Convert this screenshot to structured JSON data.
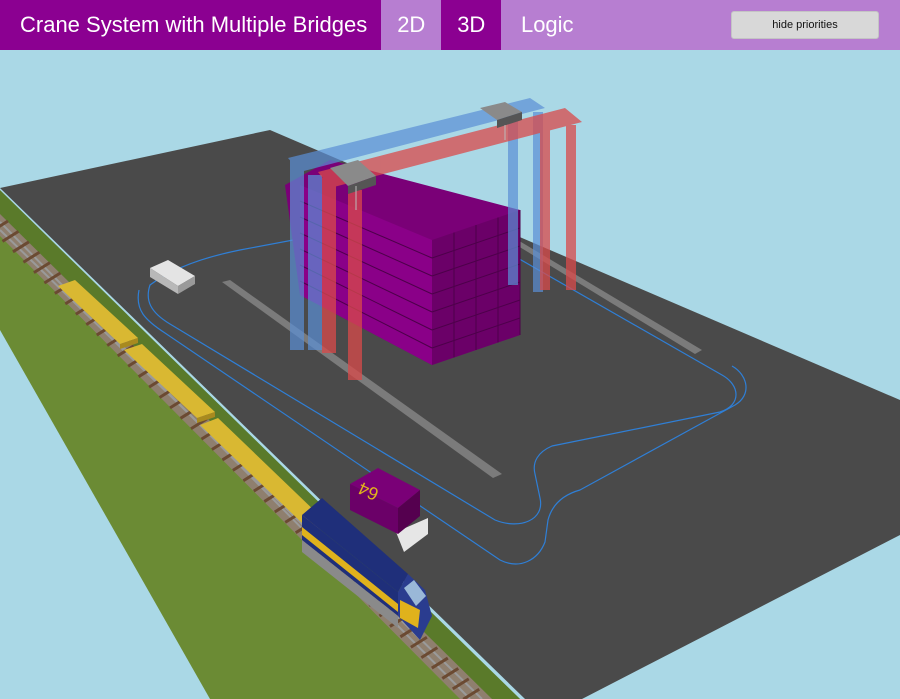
{
  "header": {
    "title": "Crane System with Multiple Bridges",
    "tabs": [
      {
        "label": "2D",
        "active": false
      },
      {
        "label": "3D",
        "active": true
      },
      {
        "label": "Logic",
        "active": false
      }
    ],
    "hide_priorities_label": "hide priorities"
  },
  "scene": {
    "loaded_container_label": "64",
    "colors": {
      "sky": "#aad8e6",
      "floor": "#4a4a4a",
      "grass": "#6b8b34",
      "container": "#7a0077",
      "bridge_blue": "#5b8fd6",
      "bridge_red": "#d94a4a",
      "wagon": "#d9b832",
      "locomotive_body": "#1f2f7a",
      "locomotive_stripe": "#e0b21c",
      "path": "#2f7fd6"
    }
  }
}
